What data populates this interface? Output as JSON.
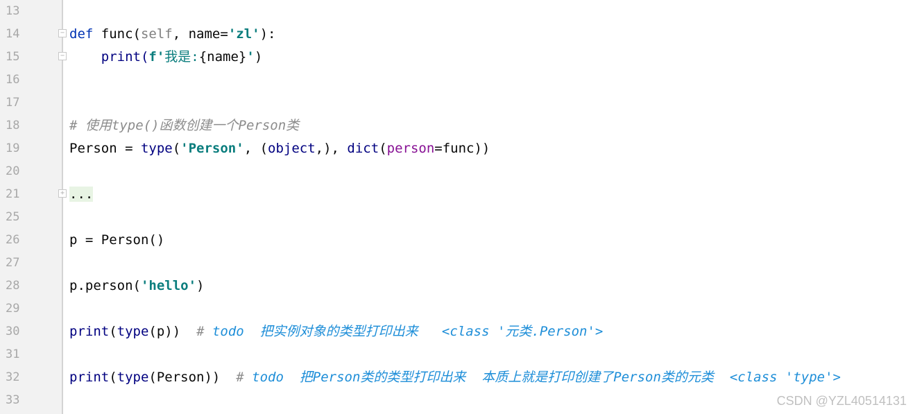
{
  "editor": {
    "lines": [
      {
        "num": "13"
      },
      {
        "num": "14",
        "parts": [
          {
            "t": "def ",
            "c": "kw"
          },
          {
            "t": "func(",
            "c": ""
          },
          {
            "t": "self",
            "c": "self"
          },
          {
            "t": ", name=",
            "c": ""
          },
          {
            "t": "'zl'",
            "c": "str"
          },
          {
            "t": "):",
            "c": ""
          }
        ]
      },
      {
        "num": "15",
        "parts": [
          {
            "t": "    print(",
            "c": "fn"
          },
          {
            "t": "f'",
            "c": "str"
          },
          {
            "t": "我是:",
            "c": "str2"
          },
          {
            "t": "{name}",
            "c": ""
          },
          {
            "t": "'",
            "c": "str"
          },
          {
            "t": ")",
            "c": ""
          }
        ]
      },
      {
        "num": "16"
      },
      {
        "num": "17"
      },
      {
        "num": "18",
        "parts": [
          {
            "t": "# 使用type()函数创建一个Person类",
            "c": "cm"
          }
        ]
      },
      {
        "num": "19",
        "parts": [
          {
            "t": "Person = ",
            "c": ""
          },
          {
            "t": "type",
            "c": "fn"
          },
          {
            "t": "(",
            "c": ""
          },
          {
            "t": "'Person'",
            "c": "str"
          },
          {
            "t": ", (",
            "c": ""
          },
          {
            "t": "object",
            "c": "fn"
          },
          {
            "t": ",), ",
            "c": ""
          },
          {
            "t": "dict",
            "c": "fn"
          },
          {
            "t": "(",
            "c": ""
          },
          {
            "t": "person",
            "c": "param"
          },
          {
            "t": "=func))",
            "c": ""
          }
        ]
      },
      {
        "num": "20"
      },
      {
        "num": "21",
        "parts": [
          {
            "t": "...",
            "c": "folded"
          }
        ]
      },
      {
        "num": "25"
      },
      {
        "num": "26",
        "parts": [
          {
            "t": "p = Person()",
            "c": ""
          }
        ]
      },
      {
        "num": "27"
      },
      {
        "num": "28",
        "parts": [
          {
            "t": "p.person(",
            "c": ""
          },
          {
            "t": "'hello'",
            "c": "str"
          },
          {
            "t": ")",
            "c": ""
          }
        ]
      },
      {
        "num": "29"
      },
      {
        "num": "30",
        "parts": [
          {
            "t": "print",
            "c": "fn"
          },
          {
            "t": "(",
            "c": ""
          },
          {
            "t": "type",
            "c": "fn"
          },
          {
            "t": "(p))  ",
            "c": ""
          },
          {
            "t": "# ",
            "c": "cm"
          },
          {
            "t": "todo  把实例对象的类型打印出来   <class '元类.Person'>",
            "c": "todo"
          }
        ]
      },
      {
        "num": "31"
      },
      {
        "num": "32",
        "parts": [
          {
            "t": "print",
            "c": "fn"
          },
          {
            "t": "(",
            "c": ""
          },
          {
            "t": "type",
            "c": "fn"
          },
          {
            "t": "(Person))  ",
            "c": ""
          },
          {
            "t": "# ",
            "c": "cm"
          },
          {
            "t": "todo  把Person类的类型打印出来  本质上就是打印创建了Person类的元类  <class 'type'>",
            "c": "todo"
          }
        ]
      },
      {
        "num": "33"
      }
    ]
  },
  "watermark": "CSDN @YZL40514131"
}
